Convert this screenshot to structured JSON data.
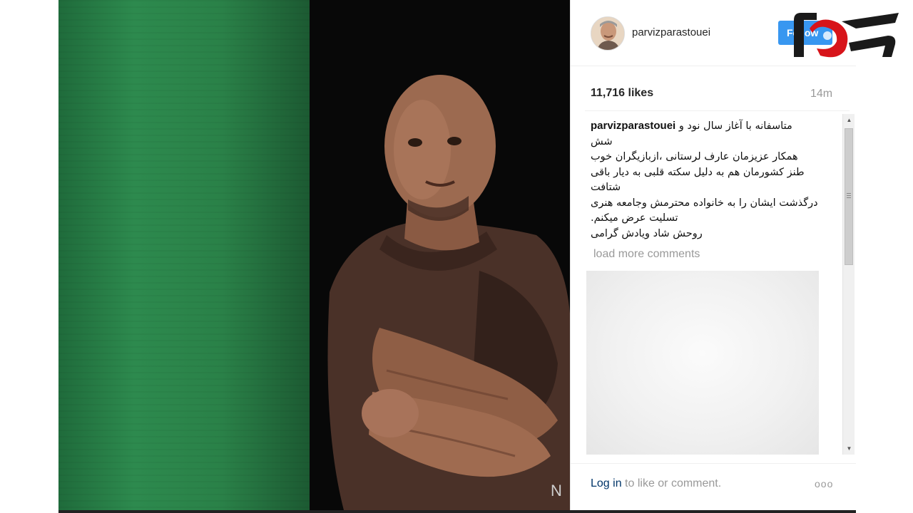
{
  "post": {
    "username": "parvizparastouei",
    "follow_label": "Follow",
    "likes": "11,716 likes",
    "time": "14m",
    "caption_user": "parvizparastouei",
    "caption_lines": [
      "متاسفانه با آغاز سال نود و",
      "شش",
      "همکار عزیزمان عارف لرستانی ،ازبازیگران خوب",
      "طنز کشورمان هم به دلیل سکته قلبی به دیار باقی",
      "شتافت",
      "درگذشت ایشان را به خانواده محترمش وجامعه هنری",
      ".تسلیت عرض میکنم",
      "روحش شاد ویادش گرامی"
    ],
    "load_more": "load more comments",
    "login_link": "Log in",
    "login_rest": " to like or comment.",
    "more_dots": "ooo"
  },
  "photo": {
    "watermark": "N"
  },
  "colors": {
    "follow_bg": "#3897f0",
    "logo_red": "#d7141a",
    "logo_dark": "#1a1a1a",
    "green_wall": "#2d8a4e"
  },
  "icons": {
    "avatar": "profile-avatar",
    "scroll_up": "scroll-up-arrow-icon",
    "scroll_down": "scroll-down-arrow-icon",
    "logo": "rokna-logo"
  }
}
